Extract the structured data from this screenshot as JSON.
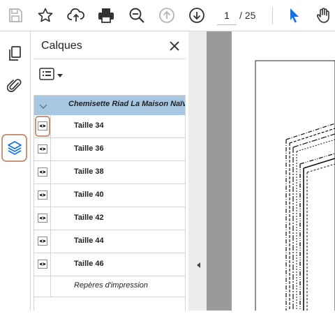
{
  "toolbar": {
    "icons": [
      "save-icon",
      "star-icon",
      "cloud-upload-icon",
      "print-icon",
      "zoom-out-icon",
      "page-up-icon",
      "page-down-icon",
      "select-cursor-icon",
      "hand-tool-icon"
    ],
    "page_current": "1",
    "page_total": "/ 25"
  },
  "rail": {
    "icons": [
      "pages-icon",
      "attachments-icon",
      "layers-icon"
    ],
    "active": "layers-icon"
  },
  "panel": {
    "title": "Calques",
    "root_layer": "Chemisette Riad La Maison Naïve",
    "layers": [
      {
        "label": "Taille 34",
        "visible": true
      },
      {
        "label": "Taille 36",
        "visible": true
      },
      {
        "label": "Taille 38",
        "visible": true
      },
      {
        "label": "Taille 40",
        "visible": true
      },
      {
        "label": "Taille 42",
        "visible": true
      },
      {
        "label": "Taille 44",
        "visible": true
      },
      {
        "label": "Taille 46",
        "visible": true
      },
      {
        "label": "Repères d'impression",
        "visible": false
      }
    ]
  },
  "colors": {
    "accent_blue": "#1473e6",
    "highlight": "#c9937a",
    "root_row_bg": "#a7c7e3"
  }
}
